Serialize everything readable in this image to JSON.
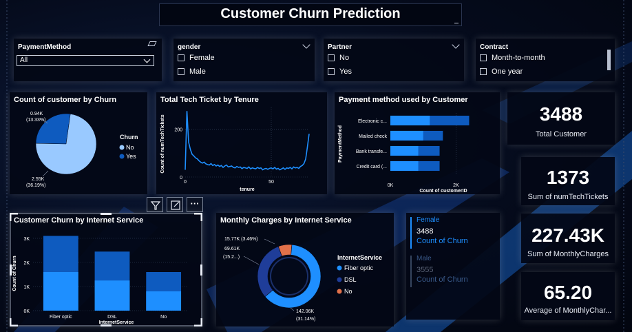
{
  "dashboard": {
    "title": "Customer Churn Prediction"
  },
  "slicers": {
    "payment_method": {
      "title": "PaymentMethod",
      "selected": "All"
    },
    "gender": {
      "title": "gender",
      "options": [
        "Female",
        "Male"
      ]
    },
    "partner": {
      "title": "Partner",
      "options": [
        "No",
        "Yes"
      ]
    },
    "contract": {
      "title": "Contract",
      "options": [
        "Month-to-month",
        "One year"
      ]
    }
  },
  "visual_header": {
    "filter_icon": "filter-icon",
    "focus_icon": "focus-mode-icon",
    "more_icon": "more-options-icon",
    "more_label": "···"
  },
  "cards": [
    {
      "value": "3488",
      "label": "Total Customer"
    },
    {
      "value": "1373",
      "label": "Sum of numTechTickets"
    },
    {
      "value": "227.43K",
      "label": "Sum of MonthlyCharges"
    },
    {
      "value": "65.20",
      "label": "Average of MonthlyChar..."
    }
  ],
  "multi_card": [
    {
      "category": "Female",
      "value": "3488",
      "measure": "Count of Churn"
    },
    {
      "category": "Male",
      "value": "3555",
      "measure": "Count of Churn"
    }
  ],
  "colors": {
    "dark_blue": "#0e5bbf",
    "light_blue": "#99c9ff",
    "accent_blue": "#1e8fff",
    "navy": "#1f3d99",
    "orange": "#e2714a"
  },
  "chart_data": [
    {
      "type": "pie",
      "title": "Count of customer by Churn",
      "legend_title": "Churn",
      "legend_position": "right",
      "slices": [
        {
          "name": "No",
          "value": 2.55,
          "label": "2.55K",
          "pct_label": "(36.19%)",
          "color": "#99c9ff"
        },
        {
          "name": "Yes",
          "value": 0.94,
          "label": "0.94K",
          "pct_label": "(13.33%)",
          "color": "#0e5bbf"
        }
      ]
    },
    {
      "type": "line",
      "title": "Total Tech Ticket by Tenure",
      "xlabel": "tenure",
      "ylabel": "Count of numTechTickets",
      "xlim": [
        0,
        72
      ],
      "ylim": [
        0,
        290
      ],
      "x_ticks": [
        "0",
        "50"
      ],
      "y_ticks": [
        "0",
        "200"
      ],
      "x": [
        0,
        1,
        2,
        3,
        4,
        5,
        6,
        7,
        8,
        9,
        10,
        11,
        12,
        13,
        14,
        15,
        16,
        17,
        18,
        19,
        20,
        21,
        22,
        23,
        24,
        25,
        26,
        27,
        28,
        29,
        30,
        31,
        32,
        33,
        34,
        35,
        36,
        37,
        38,
        39,
        40,
        41,
        42,
        43,
        44,
        45,
        46,
        47,
        48,
        49,
        50,
        51,
        52,
        53,
        54,
        55,
        56,
        57,
        58,
        59,
        60,
        61,
        62,
        63,
        64,
        65,
        66,
        67,
        68,
        69,
        70,
        71,
        72
      ],
      "y": [
        30,
        275,
        145,
        115,
        95,
        88,
        80,
        76,
        68,
        62,
        58,
        62,
        55,
        52,
        50,
        56,
        48,
        52,
        46,
        50,
        44,
        48,
        40,
        46,
        50,
        42,
        44,
        46,
        40,
        38,
        44,
        40,
        42,
        35,
        40,
        38,
        36,
        42,
        34,
        38,
        36,
        34,
        40,
        36,
        38,
        30,
        34,
        36,
        32,
        36,
        38,
        34,
        40,
        33,
        36,
        30,
        34,
        38,
        32,
        38,
        36,
        40,
        34,
        42,
        38,
        40,
        36,
        44,
        48,
        56,
        75,
        125,
        180
      ]
    },
    {
      "type": "bar",
      "orientation": "horizontal",
      "title": "Payment method used by Customer",
      "xlabel": "Count of customerID",
      "ylabel": "PaymentMethod",
      "categories": [
        "Electronic c...",
        "Mailed check",
        "Bank transfe...",
        "Credit card (..."
      ],
      "x_ticks": [
        "0K",
        "2K"
      ],
      "xlim": [
        0,
        2.6
      ],
      "series": [
        {
          "values": [
            1.2,
            1.0,
            0.85,
            0.85
          ]
        },
        {
          "values": [
            2.4,
            1.6,
            1.5,
            1.5
          ]
        }
      ]
    },
    {
      "type": "bar",
      "title": "Customer Churn by Internet Service",
      "xlabel": "InternetService",
      "ylabel": "Count of Churn",
      "categories": [
        "Fiber optic",
        "DSL",
        "No"
      ],
      "y_ticks": [
        "0K",
        "1K",
        "2K",
        "3K"
      ],
      "ylim": [
        0,
        3.2
      ],
      "series": [
        {
          "values": [
            1.6,
            1.25,
            0.8
          ]
        },
        {
          "values": [
            3.1,
            2.45,
            1.6
          ]
        }
      ]
    },
    {
      "type": "pie",
      "subtype": "donut",
      "title": "Monthly Charges by Internet Service",
      "legend_title": "InternetService",
      "legend_position": "right",
      "slices": [
        {
          "name": "Fiber optic",
          "value": 142.06,
          "label": "142.06K",
          "pct_label": "(31.14%)",
          "color": "#1e8fff"
        },
        {
          "name": "DSL",
          "value": 69.61,
          "label": "69.61K",
          "pct_label": "(15.2...)",
          "color": "#1f3d99"
        },
        {
          "name": "No",
          "value": 15.77,
          "label": "15.77K (3.46%)",
          "pct_label": "",
          "color": "#e2714a"
        }
      ]
    }
  ]
}
